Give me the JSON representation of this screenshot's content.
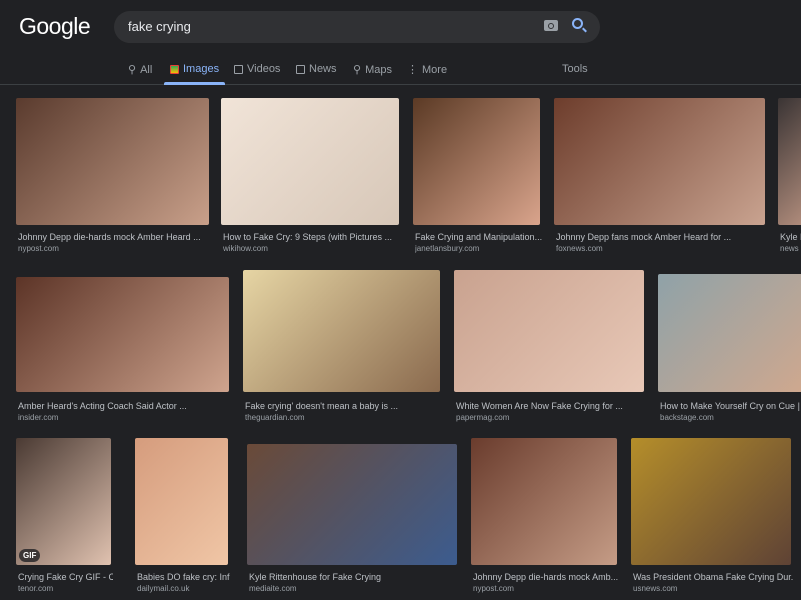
{
  "logo": "Google",
  "search": {
    "query": "fake crying"
  },
  "tabs": [
    {
      "label": "All"
    },
    {
      "label": "Images"
    },
    {
      "label": "Videos"
    },
    {
      "label": "News"
    },
    {
      "label": "Maps"
    },
    {
      "label": "More"
    }
  ],
  "tools": "Tools",
  "results": [
    {
      "title": "Johnny Depp die-hards mock Amber Heard ...",
      "source": "nypost.com",
      "colors": [
        "#5a3b2e",
        "#c9a08a"
      ]
    },
    {
      "title": "How to Fake Cry: 9 Steps (with Pictures ...",
      "source": "wikihow.com",
      "colors": [
        "#f1e4d8",
        "#d7c7b8"
      ]
    },
    {
      "title": "Fake Crying and Manipulation...",
      "source": "janetlansbury.com",
      "colors": [
        "#5b3a25",
        "#d9a48c"
      ]
    },
    {
      "title": "Johnny Depp fans mock Amber Heard for ...",
      "source": "foxnews.com",
      "colors": [
        "#6d3d2c",
        "#c9a390"
      ]
    },
    {
      "title": "Kyle R",
      "source": "news",
      "colors": [
        "#3a3434",
        "#b48f7e"
      ]
    },
    {
      "title": "Amber Heard's Acting Coach Said Actor ...",
      "source": "insider.com",
      "colors": [
        "#5c3427",
        "#cfa48e"
      ]
    },
    {
      "title": "Fake crying' doesn't mean a baby is ...",
      "source": "theguardian.com",
      "colors": [
        "#e6d5a4",
        "#8a6a4e"
      ]
    },
    {
      "title": "White Women Are Now Fake Crying for ...",
      "source": "papermag.com",
      "colors": [
        "#c9a28f",
        "#e8c8b7"
      ]
    },
    {
      "title": "How to Make Yourself Cry on Cue | B",
      "source": "backstage.com",
      "colors": [
        "#8fa2a8",
        "#d0a88e"
      ]
    },
    {
      "title": "Crying Fake Cry GIF - C...",
      "source": "tenor.com",
      "colors": [
        "#4a3a33",
        "#e0c2b0"
      ],
      "badge": "GIF"
    },
    {
      "title": "Babies DO fake cry: Inf...",
      "source": "dailymail.co.uk",
      "colors": [
        "#d59c7d",
        "#f0c6a6"
      ]
    },
    {
      "title": "Kyle Rittenhouse for Fake Crying",
      "source": "mediaite.com",
      "colors": [
        "#6a4a38",
        "#3c5c8f"
      ]
    },
    {
      "title": "Johnny Depp die-hards mock Amb...",
      "source": "nypost.com",
      "colors": [
        "#6a3c2d",
        "#c59c86"
      ]
    },
    {
      "title": "Was President Obama Fake Crying Dur...",
      "source": "usnews.com",
      "colors": [
        "#b58e2a",
        "#5e4235"
      ]
    }
  ]
}
